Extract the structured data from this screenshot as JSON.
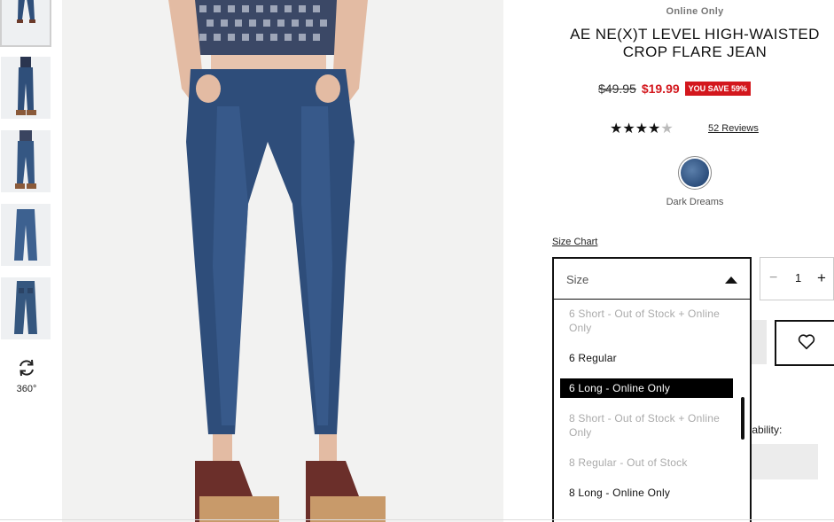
{
  "thumbnails": [
    {
      "name": "thumb-front"
    },
    {
      "name": "thumb-side"
    },
    {
      "name": "thumb-back"
    },
    {
      "name": "thumb-flat-front"
    },
    {
      "name": "thumb-flat-back"
    }
  ],
  "view360": {
    "label": "360°",
    "icon": "rotate-360-icon"
  },
  "product": {
    "availability_tag": "Online Only",
    "title": "AE NE(X)T LEVEL HIGH-WAISTED CROP FLARE JEAN",
    "old_price": "$49.95",
    "new_price": "$19.99",
    "save_badge": "YOU SAVE 59%",
    "rating_stars": 4.5,
    "reviews_label": "52 Reviews",
    "color_name": "Dark Dreams"
  },
  "colors": {
    "accent_red": "#d3171d",
    "denim": "#2c4e7c"
  },
  "size": {
    "chart_link": "Size Chart",
    "placeholder": "Size",
    "options": [
      {
        "label": "6 Short - Out of Stock + Online Only",
        "state": "disabled"
      },
      {
        "label": "6 Regular",
        "state": "enabled"
      },
      {
        "label": "6 Long - Online Only",
        "state": "highlighted"
      },
      {
        "label": "8 Short - Out of Stock + Online Only",
        "state": "disabled"
      },
      {
        "label": "8 Regular - Out of Stock",
        "state": "disabled"
      },
      {
        "label": "8 Long - Online Only",
        "state": "enabled"
      }
    ]
  },
  "quantity": {
    "minus": "−",
    "value": "1",
    "plus": "+"
  },
  "store": {
    "availability_label": "ilability:"
  }
}
